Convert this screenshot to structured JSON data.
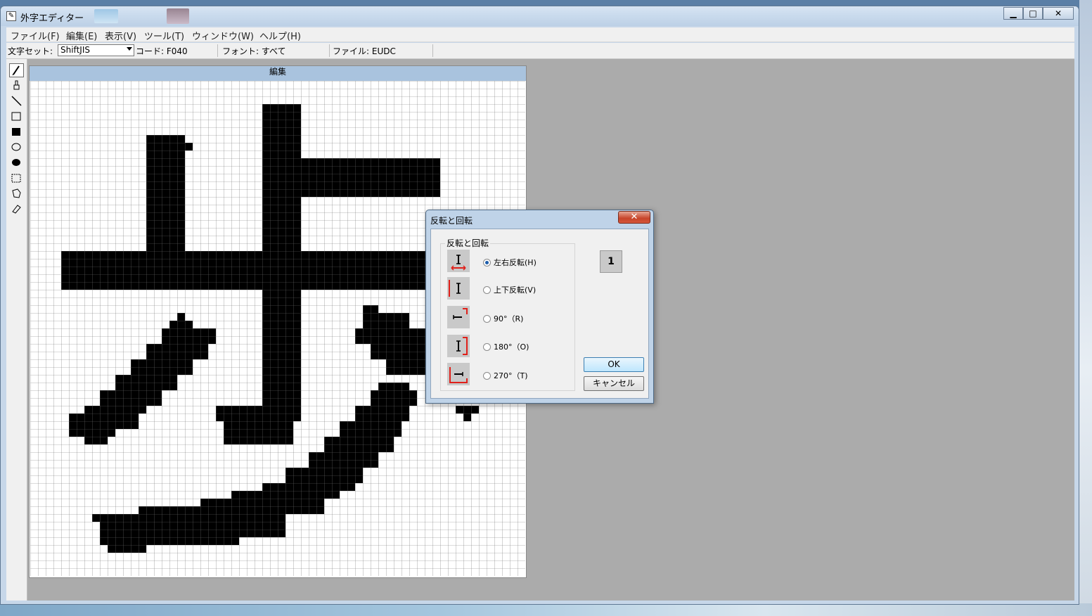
{
  "window": {
    "title": "外字エディター",
    "controls": {
      "minimize": "▁",
      "maximize": "□",
      "close": "✕"
    }
  },
  "menu": [
    "ファイル(F)",
    "編集(E)",
    "表示(V)",
    "ツール(T)",
    "ウィンドウ(W)",
    "ヘルプ(H)"
  ],
  "toolbar": {
    "charset_label": "文字セット:",
    "charset_value": "ShiftJIS",
    "code": "コード: F040",
    "font": "フォント: すべて",
    "file": "ファイル: EUDC"
  },
  "tools": [
    "pencil-icon",
    "brush-icon",
    "line-icon",
    "hollow-rectangle-icon",
    "filled-rectangle-icon",
    "hollow-ellipse-icon",
    "filled-ellipse-icon",
    "rectangle-select-icon",
    "freeform-select-icon",
    "eraser-icon"
  ],
  "editor": {
    "header": "編集",
    "grid_cells": 64,
    "glyph_shown": "歩"
  },
  "dialog": {
    "title": "反転と回転",
    "close": "✕",
    "group_label": "反転と回転",
    "options": [
      {
        "label": "左右反転(H)",
        "selected": true
      },
      {
        "label": "上下反転(V)",
        "selected": false
      },
      {
        "label": "90°（R)",
        "selected": false
      },
      {
        "label": "180°（O)",
        "selected": false
      },
      {
        "label": "270°（T)",
        "selected": false
      }
    ],
    "preview_glyph": "1",
    "ok": "OK",
    "cancel": "キャンセル"
  },
  "colors": {
    "accent": "#3c7fb1",
    "arrow_red": "#e0201a",
    "pixel_on": "#000000"
  }
}
